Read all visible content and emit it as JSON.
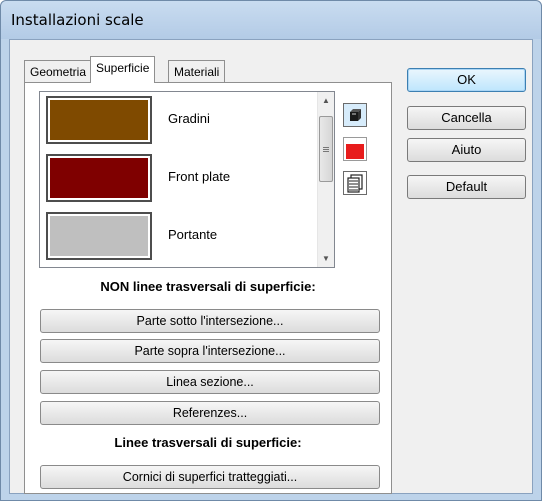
{
  "window": {
    "title": "Installazioni scale"
  },
  "tabs": [
    {
      "label": "Geometria",
      "active": false
    },
    {
      "label": "Superficie",
      "active": true
    },
    {
      "label": "Materiali",
      "active": false
    }
  ],
  "surfaces": [
    {
      "label": "Gradini",
      "color": "#7f4a00"
    },
    {
      "label": "Front plate",
      "color": "#7f0000"
    },
    {
      "label": "Portante",
      "color": "#bfbfbf"
    }
  ],
  "tools": [
    {
      "name": "3d-cube-icon"
    },
    {
      "name": "color-fill-icon",
      "color": "#e81c1c"
    },
    {
      "name": "hatch-layers-icon"
    }
  ],
  "section1": {
    "heading": "NON linee trasversali di superficie:",
    "buttons": [
      "Parte sotto l'intersezione...",
      "Parte sopra l'intersezione...",
      "Linea sezione...",
      "Referenzes..."
    ]
  },
  "section2": {
    "heading": "Linee trasversali di superficie:",
    "buttons": [
      "Cornici di superfici tratteggiati..."
    ]
  },
  "actions": {
    "ok": "OK",
    "cancel": "Cancella",
    "help": "Aiuto",
    "default": "Default"
  }
}
